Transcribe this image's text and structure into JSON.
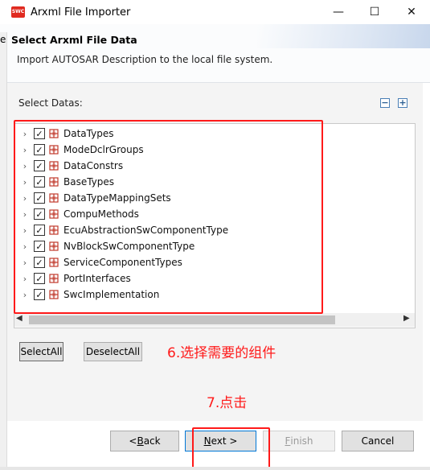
{
  "window": {
    "title": "Arxml File Importer",
    "app_icon_text": "SWC",
    "minimize_glyph": "—",
    "maximize_glyph": "☐",
    "close_glyph": "✕",
    "left_edge_text": "e"
  },
  "header": {
    "title": "Select Arxml File Data",
    "description": "Import AUTOSAR Description to the local file system."
  },
  "main": {
    "select_label": "Select Datas:",
    "toolbar": {
      "collapse_all_glyph": "−",
      "expand_all_glyph": "+"
    },
    "tree_items": [
      {
        "label": "DataTypes",
        "checked": true
      },
      {
        "label": "ModeDclrGroups",
        "checked": true
      },
      {
        "label": "DataConstrs",
        "checked": true
      },
      {
        "label": "BaseTypes",
        "checked": true
      },
      {
        "label": "DataTypeMappingSets",
        "checked": true
      },
      {
        "label": "CompuMethods",
        "checked": true
      },
      {
        "label": "EcuAbstractionSwComponentType",
        "checked": true
      },
      {
        "label": "NvBlockSwComponentType",
        "checked": true
      },
      {
        "label": "ServiceComponentTypes",
        "checked": true
      },
      {
        "label": "PortInterfaces",
        "checked": true
      },
      {
        "label": "SwcImplementation",
        "checked": true
      }
    ],
    "select_all_label": "SelectAll",
    "deselect_all_label": "DeselectAll"
  },
  "footer": {
    "back_label": "< Back",
    "next_label": "Next >",
    "finish_label": "Finish",
    "cancel_label": "Cancel"
  },
  "annotations": {
    "step6": "6.选择需要的组件",
    "step7": "7.点击",
    "color": "#ff1a1a"
  },
  "colors": {
    "package_icon": "#c0392b",
    "focus_blue": "#0078d7"
  }
}
